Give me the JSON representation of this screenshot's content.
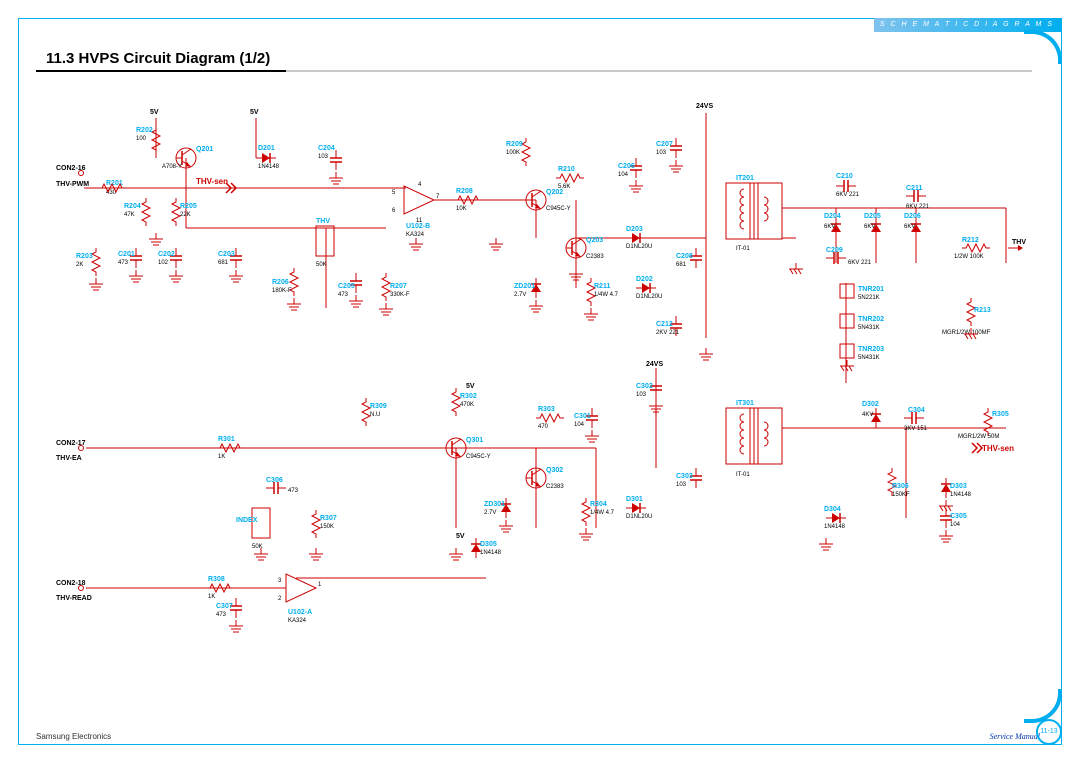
{
  "doc": {
    "header_banner": "S C H E M A T I C   D I A G R A M S",
    "title": "11.3 HVPS Circuit Diagram (1/2)",
    "footer_left": "Samsung Electronics",
    "footer_right": "Service Manual",
    "page_num": "11-13"
  },
  "signals": {
    "vcc5_a": "5V",
    "vcc5_b": "5V",
    "vcc5_c": "5V",
    "vcc5_d": "5V",
    "v24_a": "24VS",
    "v24_b": "24VS",
    "thv_sen_a": "THV-sen",
    "thv_sen_b": "THV-sen",
    "thv": "THV",
    "index": "INDEX",
    "con2_16": "CON2-16",
    "thv_pwm": "THV-PWM",
    "con2_17": "CON2-17",
    "thv_ea": "THV-EA",
    "con2_18": "CON2-18",
    "thv_read": "THV-READ"
  },
  "parts": {
    "R201": {
      "ref": "R201",
      "val": "430"
    },
    "R202": {
      "ref": "R202",
      "val": "100"
    },
    "R203": {
      "ref": "R203",
      "val": "2K"
    },
    "R204": {
      "ref": "R204",
      "val": "47K"
    },
    "R205": {
      "ref": "R205",
      "val": "22K"
    },
    "R206": {
      "ref": "R206",
      "val": "180K-F"
    },
    "R207": {
      "ref": "R207",
      "val": "330K-F"
    },
    "R208": {
      "ref": "R208",
      "val": "10K"
    },
    "R209": {
      "ref": "R209",
      "val": "100K"
    },
    "R210": {
      "ref": "R210",
      "val": "5.6K"
    },
    "R211": {
      "ref": "R211",
      "val": "1/4W 4.7"
    },
    "R212": {
      "ref": "R212",
      "val": "1/2W 100K"
    },
    "R213": {
      "ref": "R213",
      "val": "MGR1/2W 100MF"
    },
    "R301": {
      "ref": "R301",
      "val": "1K"
    },
    "R302": {
      "ref": "R302",
      "val": "470K"
    },
    "R303": {
      "ref": "R303",
      "val": "470"
    },
    "R304": {
      "ref": "R304",
      "val": "1/4W 4.7"
    },
    "R305": {
      "ref": "R305",
      "val": "MGR1/2W 50M"
    },
    "R306": {
      "ref": "R306",
      "val": "150KF"
    },
    "R307": {
      "ref": "R307",
      "val": "150K"
    },
    "R308": {
      "ref": "R308",
      "val": "1K"
    },
    "R309": {
      "ref": "R309",
      "val": "N.U"
    },
    "C201": {
      "ref": "C201",
      "val": "473"
    },
    "C202": {
      "ref": "C202",
      "val": "102"
    },
    "C203": {
      "ref": "C203",
      "val": "681"
    },
    "C204": {
      "ref": "C204",
      "val": "103"
    },
    "C205": {
      "ref": "C205",
      "val": "473"
    },
    "C206": {
      "ref": "C206",
      "val": "104"
    },
    "C207": {
      "ref": "C207",
      "val": "103"
    },
    "C208": {
      "ref": "C208",
      "val": "681"
    },
    "C209": {
      "ref": "C209",
      "val": "6KV 221"
    },
    "C210": {
      "ref": "C210",
      "val": "6KV 221"
    },
    "C211": {
      "ref": "C211",
      "val": "6KV 221"
    },
    "C212": {
      "ref": "C212",
      "val": "2KV 221"
    },
    "C301": {
      "ref": "C301",
      "val": "104"
    },
    "C302": {
      "ref": "C302",
      "val": "103"
    },
    "C303": {
      "ref": "C303",
      "val": "103"
    },
    "C304": {
      "ref": "C304",
      "val": "3KV 151"
    },
    "C305": {
      "ref": "C305",
      "val": "104"
    },
    "C306": {
      "ref": "C306",
      "val": "473"
    },
    "C307": {
      "ref": "C307",
      "val": "473"
    },
    "D201": {
      "ref": "D201",
      "val": "1N4148"
    },
    "D202": {
      "ref": "D202",
      "val": "D1NL20U"
    },
    "D203": {
      "ref": "D203",
      "val": "D1NL20U"
    },
    "D204": {
      "ref": "D204",
      "val": "6KV"
    },
    "D205": {
      "ref": "D205",
      "val": "6KV"
    },
    "D206": {
      "ref": "D206",
      "val": "6KV"
    },
    "D301": {
      "ref": "D301",
      "val": "D1NL20U"
    },
    "D302": {
      "ref": "D302",
      "val": "4KV"
    },
    "D303": {
      "ref": "D303",
      "val": "1N4148"
    },
    "D304": {
      "ref": "D304",
      "val": "1N4148"
    },
    "D305": {
      "ref": "D305",
      "val": "1N4148"
    },
    "ZD201": {
      "ref": "ZD201",
      "val": "2.7V"
    },
    "ZD301": {
      "ref": "ZD301",
      "val": "2.7V"
    },
    "Q201": {
      "ref": "Q201",
      "val": "A708-Y"
    },
    "Q202": {
      "ref": "Q202",
      "val": "C945C-Y"
    },
    "Q203": {
      "ref": "Q203",
      "val": "C2383"
    },
    "Q301": {
      "ref": "Q301",
      "val": "C945C-Y"
    },
    "Q302": {
      "ref": "Q302",
      "val": "C2383"
    },
    "U102B": {
      "ref": "U102-B",
      "val": "KA324"
    },
    "U102A": {
      "ref": "U102-A",
      "val": "KA324"
    },
    "IT201": {
      "ref": "IT201",
      "val": "IT-01"
    },
    "IT301": {
      "ref": "IT301",
      "val": "IT-01"
    },
    "TNR201": {
      "ref": "TNR201",
      "val": "5N221K"
    },
    "TNR202": {
      "ref": "TNR202",
      "val": "5N431K"
    },
    "TNR203": {
      "ref": "TNR203",
      "val": "5N431K"
    },
    "THVpot": {
      "ref": "THV",
      "val": "50K"
    },
    "INDEXpot": {
      "ref": "INDEX",
      "val": "50K"
    }
  }
}
